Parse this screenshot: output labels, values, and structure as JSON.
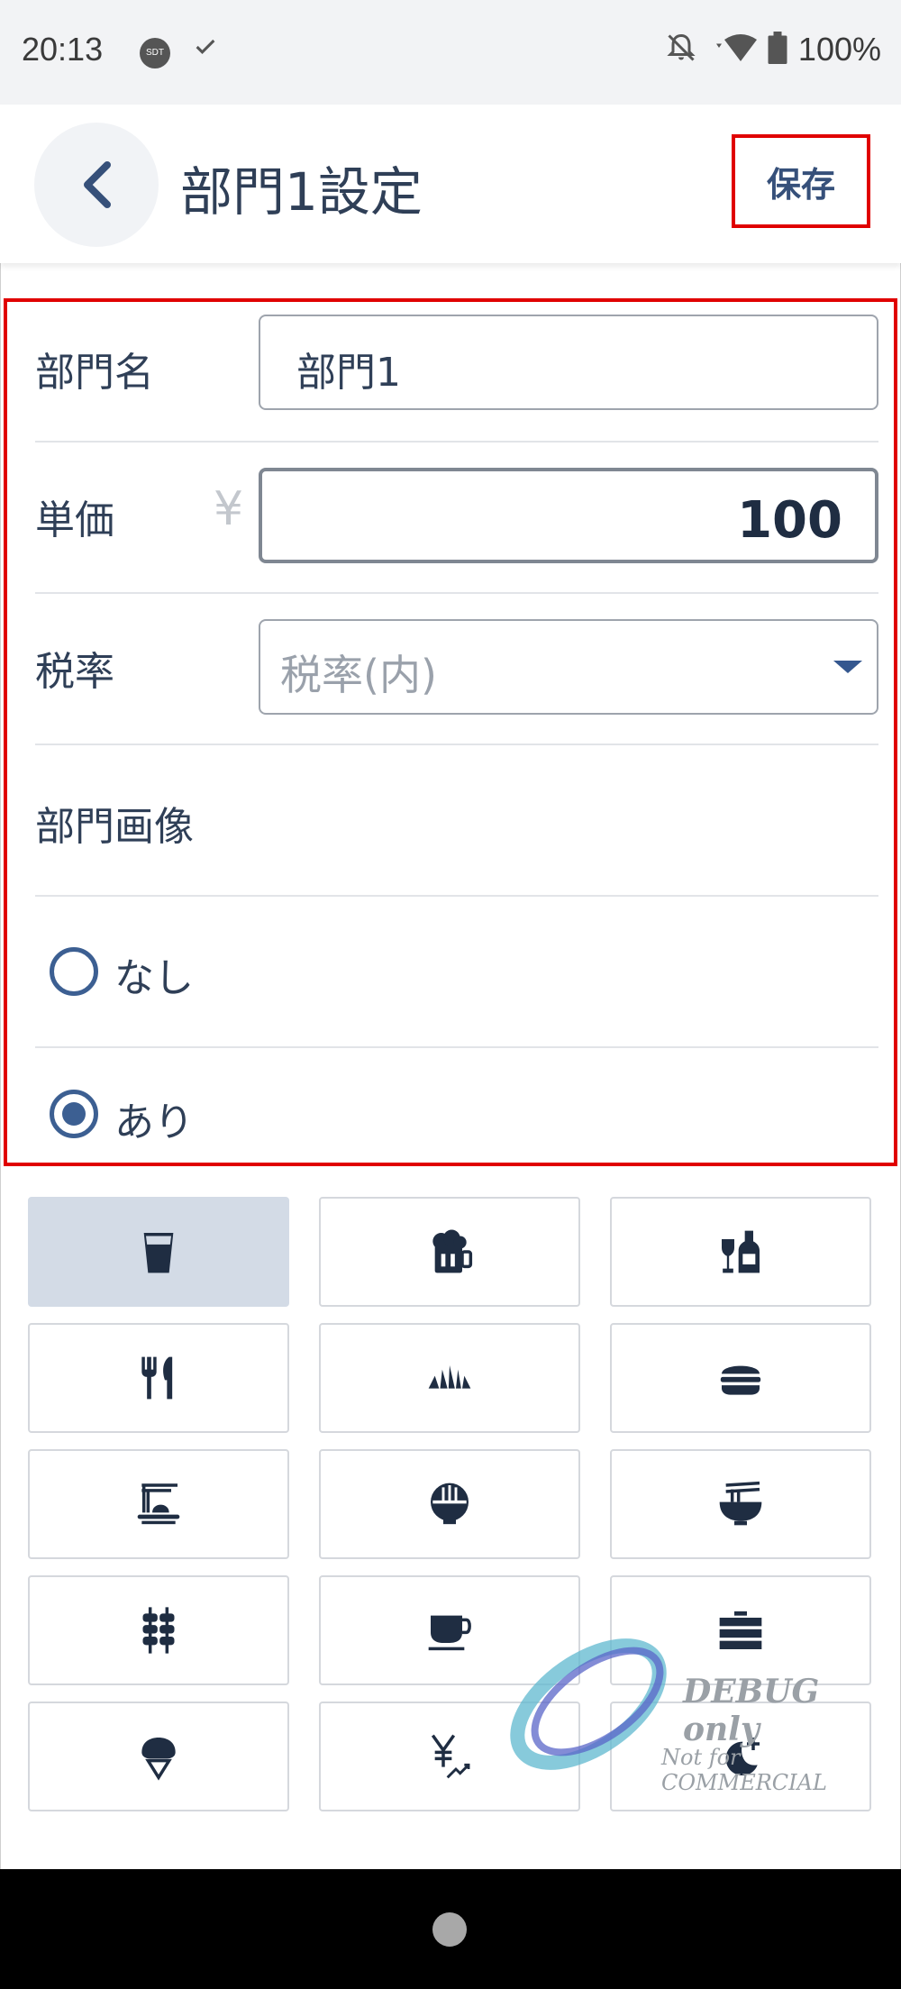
{
  "status_bar": {
    "time": "20:13",
    "sdt_badge": "SDT",
    "battery_text": "100%"
  },
  "header": {
    "title": "部門1設定",
    "save_label": "保存"
  },
  "form": {
    "department_name": {
      "label": "部門名",
      "value": "部門1"
    },
    "unit_price": {
      "label": "単価",
      "currency": "¥",
      "value": "100"
    },
    "tax_rate": {
      "label": "税率",
      "placeholder": "税率(内)"
    },
    "department_image": {
      "label": "部門画像",
      "options": [
        {
          "label": "なし",
          "checked": false
        },
        {
          "label": "あり",
          "checked": true
        }
      ]
    }
  },
  "icon_grid": {
    "icons": [
      {
        "name": "glass-icon",
        "selected": true
      },
      {
        "name": "beer-mug-icon",
        "selected": false
      },
      {
        "name": "wine-bottle-icon",
        "selected": false
      },
      {
        "name": "fork-knife-icon",
        "selected": false
      },
      {
        "name": "croissant-icon",
        "selected": false
      },
      {
        "name": "hamburger-icon",
        "selected": false
      },
      {
        "name": "spaghetti-plate-icon",
        "selected": false
      },
      {
        "name": "rice-bowl-icon",
        "selected": false
      },
      {
        "name": "noodle-bowl-icon",
        "selected": false
      },
      {
        "name": "skewer-icon",
        "selected": false
      },
      {
        "name": "coffee-cup-icon",
        "selected": false
      },
      {
        "name": "layered-cake-icon",
        "selected": false
      },
      {
        "name": "ice-cream-icon",
        "selected": false
      },
      {
        "name": "yen-trend-icon",
        "selected": false
      },
      {
        "name": "moon-plus-icon",
        "selected": false
      }
    ]
  },
  "watermark": {
    "line1": "DEBUG only",
    "line2": "Not for COMMERCIAL"
  },
  "colors": {
    "accent": "#36507a",
    "highlight_border": "#e00000",
    "selected_cell": "#d3dbe6"
  }
}
